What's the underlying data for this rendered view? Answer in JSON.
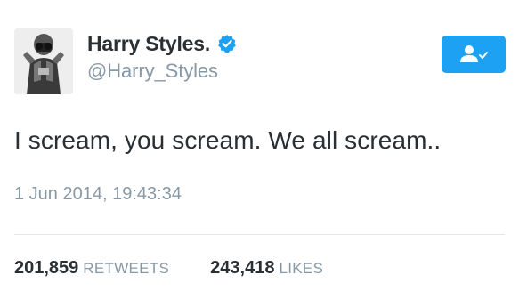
{
  "user": {
    "display_name": "Harry Styles.",
    "handle": "@Harry_Styles",
    "verified_icon": "verified-badge-icon"
  },
  "follow_button": {
    "icon": "follow-user-icon"
  },
  "tweet": {
    "text": "I scream, you scream. We all scream..",
    "timestamp": "1 Jun 2014, 19:43:34"
  },
  "stats": {
    "retweets": {
      "count": "201,859",
      "label": "RETWEETS"
    },
    "likes": {
      "count": "243,418",
      "label": "LIKES"
    }
  },
  "colors": {
    "accent": "#1da1f2",
    "text": "#292f33",
    "muted": "#8899a6",
    "divider": "#e1e8ed"
  }
}
